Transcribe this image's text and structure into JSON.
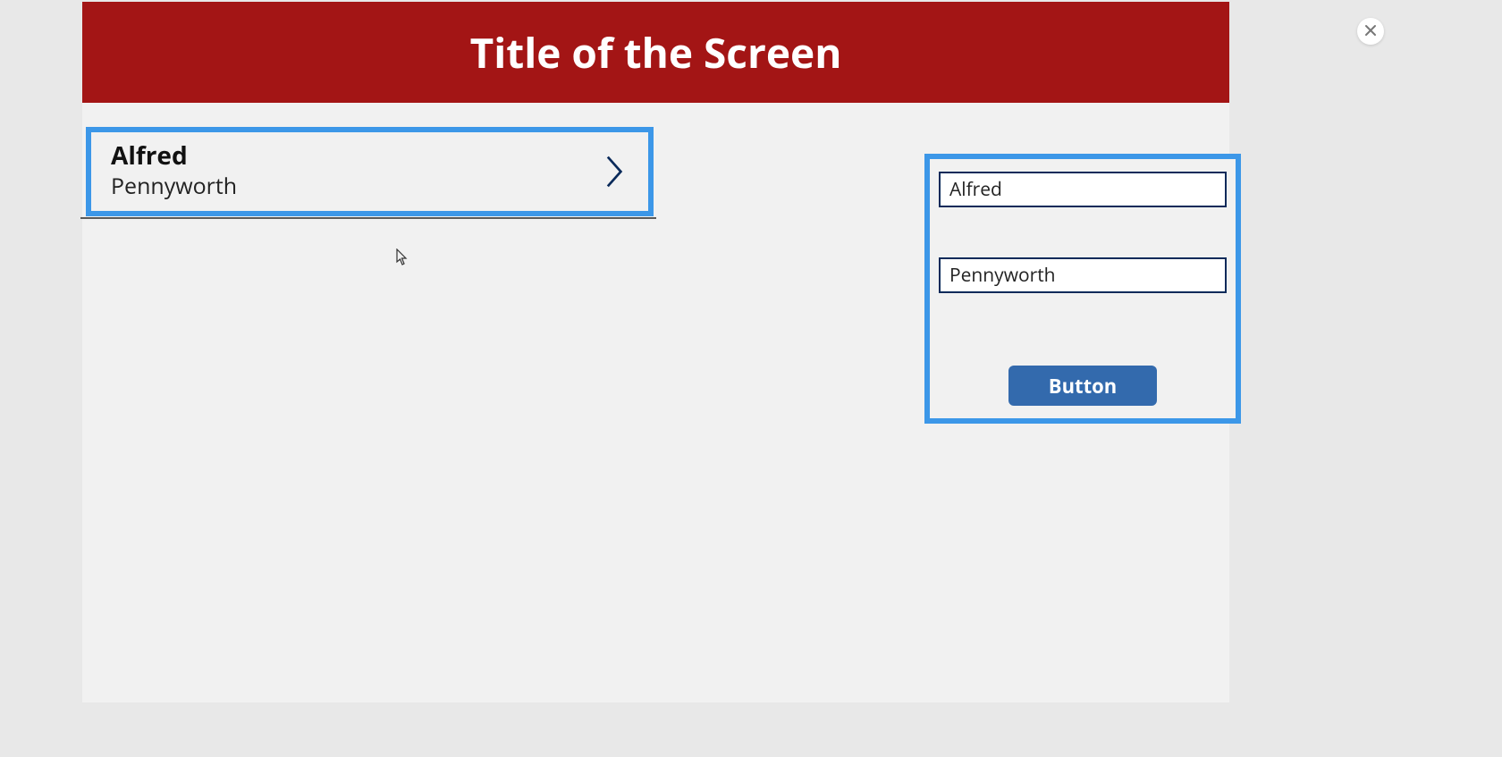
{
  "header": {
    "title": "Title of the Screen"
  },
  "list": {
    "item": {
      "title": "Alfred",
      "subtitle": "Pennyworth"
    }
  },
  "form": {
    "field1_value": "Alfred",
    "field2_value": "Pennyworth",
    "button_label": "Button"
  },
  "colors": {
    "header_bg": "#a31515",
    "highlight_border": "#3c97e8",
    "input_border": "#0a2a5a",
    "button_bg": "#336aad"
  }
}
